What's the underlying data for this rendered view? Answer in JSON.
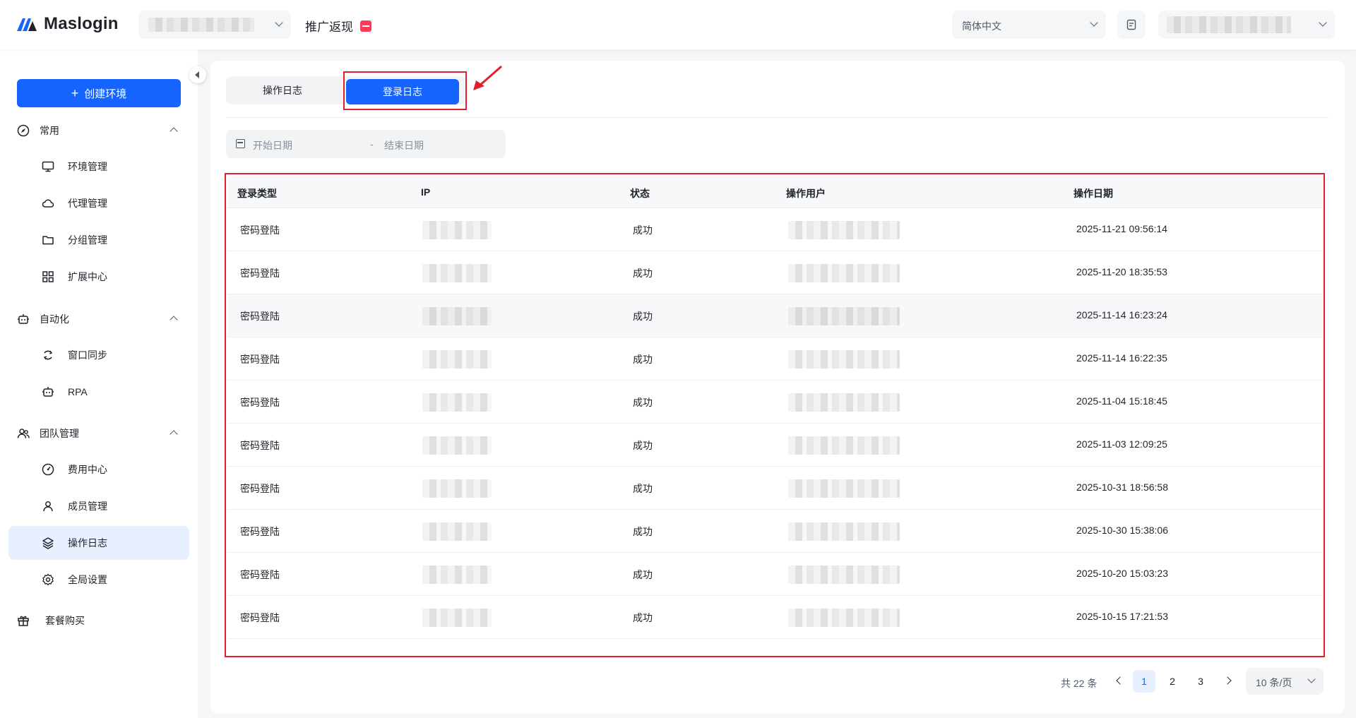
{
  "header": {
    "brand": "Maslogin",
    "promo_label": "推广返现",
    "language": "简体中文"
  },
  "sidebar": {
    "create_button": "创建环境",
    "groups": [
      {
        "label": "常用",
        "items": [
          "环境管理",
          "代理管理",
          "分组管理",
          "扩展中心"
        ]
      },
      {
        "label": "自动化",
        "items": [
          "窗口同步",
          "RPA"
        ]
      },
      {
        "label": "团队管理",
        "items": [
          "费用中心",
          "成员管理",
          "操作日志",
          "全局设置"
        ]
      }
    ],
    "bottom_item": "套餐购买",
    "active_item": "操作日志"
  },
  "tabs": [
    {
      "label": "操作日志",
      "active": false
    },
    {
      "label": "登录日志",
      "active": true
    }
  ],
  "date_range": {
    "start_placeholder": "开始日期",
    "separator": "-",
    "end_placeholder": "结束日期"
  },
  "table": {
    "columns": [
      "登录类型",
      "IP",
      "状态",
      "操作用户",
      "操作日期"
    ],
    "rows": [
      {
        "type": "密码登陆",
        "status": "成功",
        "date": "2025-11-21 09:56:14"
      },
      {
        "type": "密码登陆",
        "status": "成功",
        "date": "2025-11-20 18:35:53"
      },
      {
        "type": "密码登陆",
        "status": "成功",
        "date": "2025-11-14 16:23:24"
      },
      {
        "type": "密码登陆",
        "status": "成功",
        "date": "2025-11-14 16:22:35"
      },
      {
        "type": "密码登陆",
        "status": "成功",
        "date": "2025-11-04 15:18:45"
      },
      {
        "type": "密码登陆",
        "status": "成功",
        "date": "2025-11-03 12:09:25"
      },
      {
        "type": "密码登陆",
        "status": "成功",
        "date": "2025-10-31 18:56:58"
      },
      {
        "type": "密码登陆",
        "status": "成功",
        "date": "2025-10-30 15:38:06"
      },
      {
        "type": "密码登陆",
        "status": "成功",
        "date": "2025-10-20 15:03:23"
      },
      {
        "type": "密码登陆",
        "status": "成功",
        "date": "2025-10-15 17:21:53"
      }
    ]
  },
  "pagination": {
    "total_label": "共 22 条",
    "pages": [
      "1",
      "2",
      "3"
    ],
    "current": "1",
    "page_size": "10 条/页"
  },
  "colors": {
    "accent": "#1664ff",
    "highlight": "#e0202a",
    "active_bg": "#e8f0ff"
  }
}
